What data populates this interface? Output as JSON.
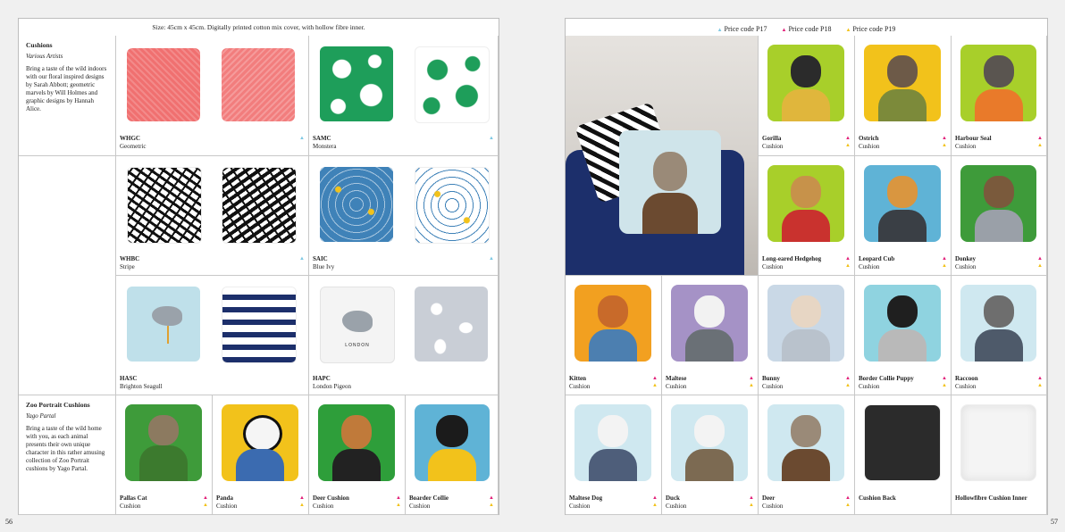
{
  "left_page": {
    "header": "Size: 45cm x 45cm.      Digitally printed cotton mix cover, with hollow fibre inner.",
    "page_number": "56",
    "sections": [
      {
        "title": "Cushions",
        "designer": "Various Artists",
        "description": "Bring a taste of the wild indoors with our floral inspired designs by Sarah Abbott; geometric marvels by Will Holmes and graphic designs by Hannah Alice."
      },
      {
        "title": "Zoo Portrait Cushions",
        "designer": "Yago Partal",
        "description": "Bring a taste of the wild home with you, as each animal presents their own unique character in this rather amusing collection of Zoo Portrait cushions by Yago Partal."
      }
    ],
    "products": [
      {
        "code": "WHGC",
        "name": "Geometric",
        "price": "P17"
      },
      {
        "code": "SAMC",
        "name": "Monstera",
        "price": "P17"
      },
      {
        "code": "WHBC",
        "name": "Stripe",
        "price": "P17"
      },
      {
        "code": "SAIC",
        "name": "Blue Ivy",
        "price": "P17"
      },
      {
        "code": "HASC",
        "name": "Brighton Seagull",
        "price": ""
      },
      {
        "code": "HAPC",
        "name": "London Pigeon",
        "price": ""
      },
      {
        "code": "Pallas Cat",
        "name": "Cushion",
        "price": "P18/P19"
      },
      {
        "code": "Panda",
        "name": "Cushion",
        "price": "P18/P19"
      },
      {
        "code": "Deer Cushion",
        "name": "Cushion",
        "price": "P18/P19"
      },
      {
        "code": "Boarder Collie",
        "name": "Cushion",
        "price": "P18/P19"
      }
    ],
    "london_text": "LONDON"
  },
  "right_page": {
    "page_number": "57",
    "legend": [
      {
        "label": "Price code P17",
        "color": "#7ec8e3",
        "symbol": "▲"
      },
      {
        "label": "Price code P18",
        "color": "#e2217a",
        "symbol": "▲"
      },
      {
        "label": "Price code P19",
        "color": "#f2c21b",
        "symbol": "▲"
      }
    ],
    "products": [
      {
        "code": "Gorilla",
        "name": "Cushion"
      },
      {
        "code": "Ostrich",
        "name": "Cushion"
      },
      {
        "code": "Harbour Seal",
        "name": "Cushion"
      },
      {
        "code": "Long-eared Hedgehog",
        "name": "Cushion"
      },
      {
        "code": "Leopard Cub",
        "name": "Cushion"
      },
      {
        "code": "Donkey",
        "name": "Cushion"
      },
      {
        "code": "Kitten",
        "name": "Cushion"
      },
      {
        "code": "Maltese",
        "name": "Cushion"
      },
      {
        "code": "Bunny",
        "name": "Cushion"
      },
      {
        "code": "Border Collie Puppy",
        "name": "Cushion"
      },
      {
        "code": "Raccoon",
        "name": "Cushion"
      },
      {
        "code": "Maltese Dog",
        "name": "Cushion"
      },
      {
        "code": "Duck",
        "name": "Cushion"
      },
      {
        "code": "Deer",
        "name": "Cushion"
      },
      {
        "code": "Cushion Back",
        "name": ""
      },
      {
        "code": "Hollowfibre Cushion Inner",
        "name": ""
      }
    ]
  },
  "colors": {
    "p17": "#7ec8e3",
    "p18": "#e2217a",
    "p19": "#f2c21b",
    "coral": "#f06a6a",
    "monstera_green": "#1e9e5a",
    "ivy_blue": "#3f82b8",
    "navy_sofa": "#1c2f6b"
  }
}
